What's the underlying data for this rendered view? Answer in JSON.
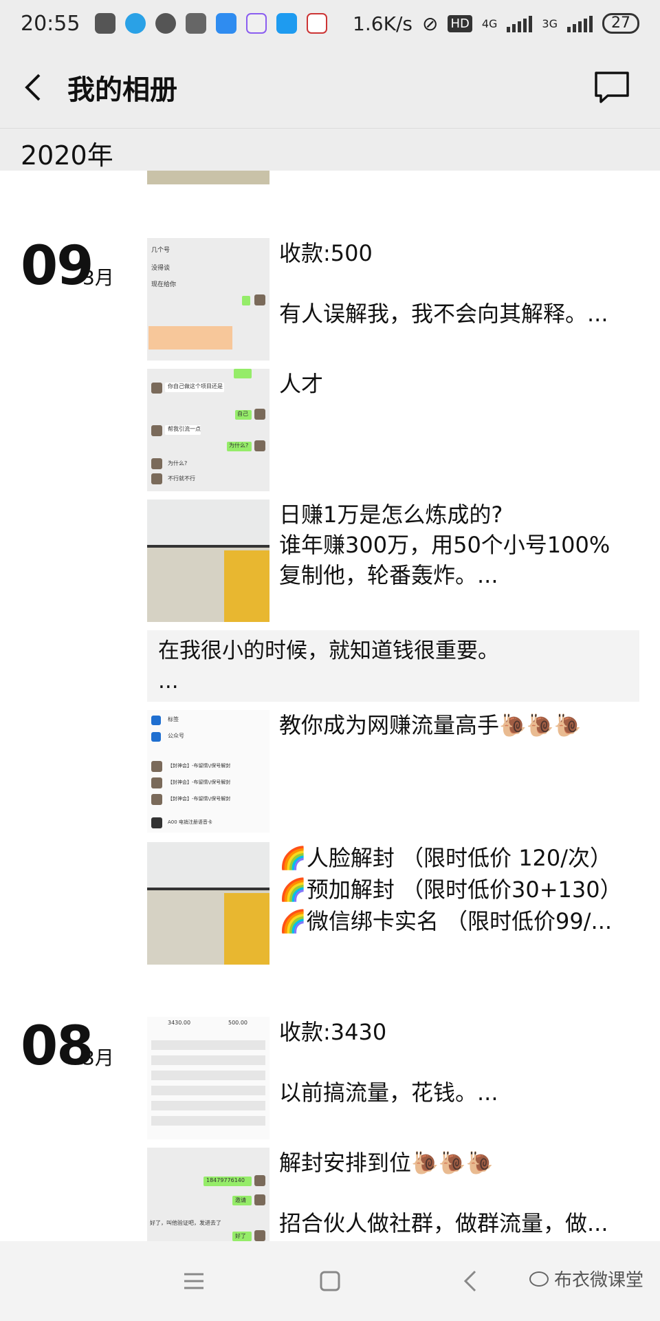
{
  "status_bar": {
    "time": "20:55",
    "net_speed": "1.6K/s",
    "hd": "HD",
    "net1": "4G",
    "net2": "3G",
    "battery": "27"
  },
  "title_bar": {
    "title": "我的相册",
    "back_icon": "chevron-left-icon",
    "message_icon": "message-icon"
  },
  "year": "2020年",
  "days": [
    {
      "day": "09",
      "month": "3月",
      "entries": [
        {
          "lines": [
            "收款:500",
            "",
            "有人误解我，我不会向其解释。..."
          ]
        },
        {
          "lines": [
            "人才"
          ]
        },
        {
          "lines": [
            "日赚1万是怎么炼成的?",
            "谁年赚300万，用50个小号100%",
            "复制他，轮番轰炸。..."
          ]
        }
      ],
      "text_post": [
        "在我很小的时候，就知道钱很重要。",
        "..."
      ],
      "entries2": [
        {
          "lines": [
            "教你成为网赚流量高手🐌🐌🐌"
          ]
        },
        {
          "lines": [
            "🌈人脸解封  （限时低价 120/次）",
            "🌈预加解封  （限时低价30+130）",
            "🌈微信绑卡实名 （限时低价99/..."
          ]
        }
      ]
    },
    {
      "day": "08",
      "month": "3月",
      "entries": [
        {
          "lines": [
            "收款:3430",
            "",
            "以前搞流量，花钱。..."
          ]
        },
        {
          "lines": [
            "解封安排到位🐌🐌🐌",
            "",
            "招合伙人做社群，做群流量，做..."
          ]
        }
      ]
    }
  ],
  "thumb_texts": {
    "t3_1": "标签",
    "t3_2": "公众号",
    "t3_3": "【封神会】-布留情\\/保号解封",
    "t3_4": "【封神会】-布留情\\/保号解封",
    "t3_5": "【封神会】-布留情\\/保号解封",
    "t3_6": "A00 电销注册语音卡",
    "t1_1": "几个号",
    "t1_2": "没得谈",
    "t1_3": "现在给你",
    "t2_1": "你自己做这个项目还是",
    "t2_2": "帮我引流一点",
    "t2_3": "为什么?",
    "t2_4": "不行就不行",
    "t2_5": "为什么?",
    "t2_6": "自己",
    "t6_1": "3430.00",
    "t6_2": "500.00",
    "t7_1": "18479776140",
    "t7_2": "好了，叫他验证吧，发进去了",
    "t7_3": "邀请",
    "t7_4": "好了"
  },
  "nav": {
    "menu_icon": "menu-icon",
    "home_icon": "square-home-icon",
    "back_icon": "back-arrow-icon"
  },
  "watermark": "布衣微课堂"
}
